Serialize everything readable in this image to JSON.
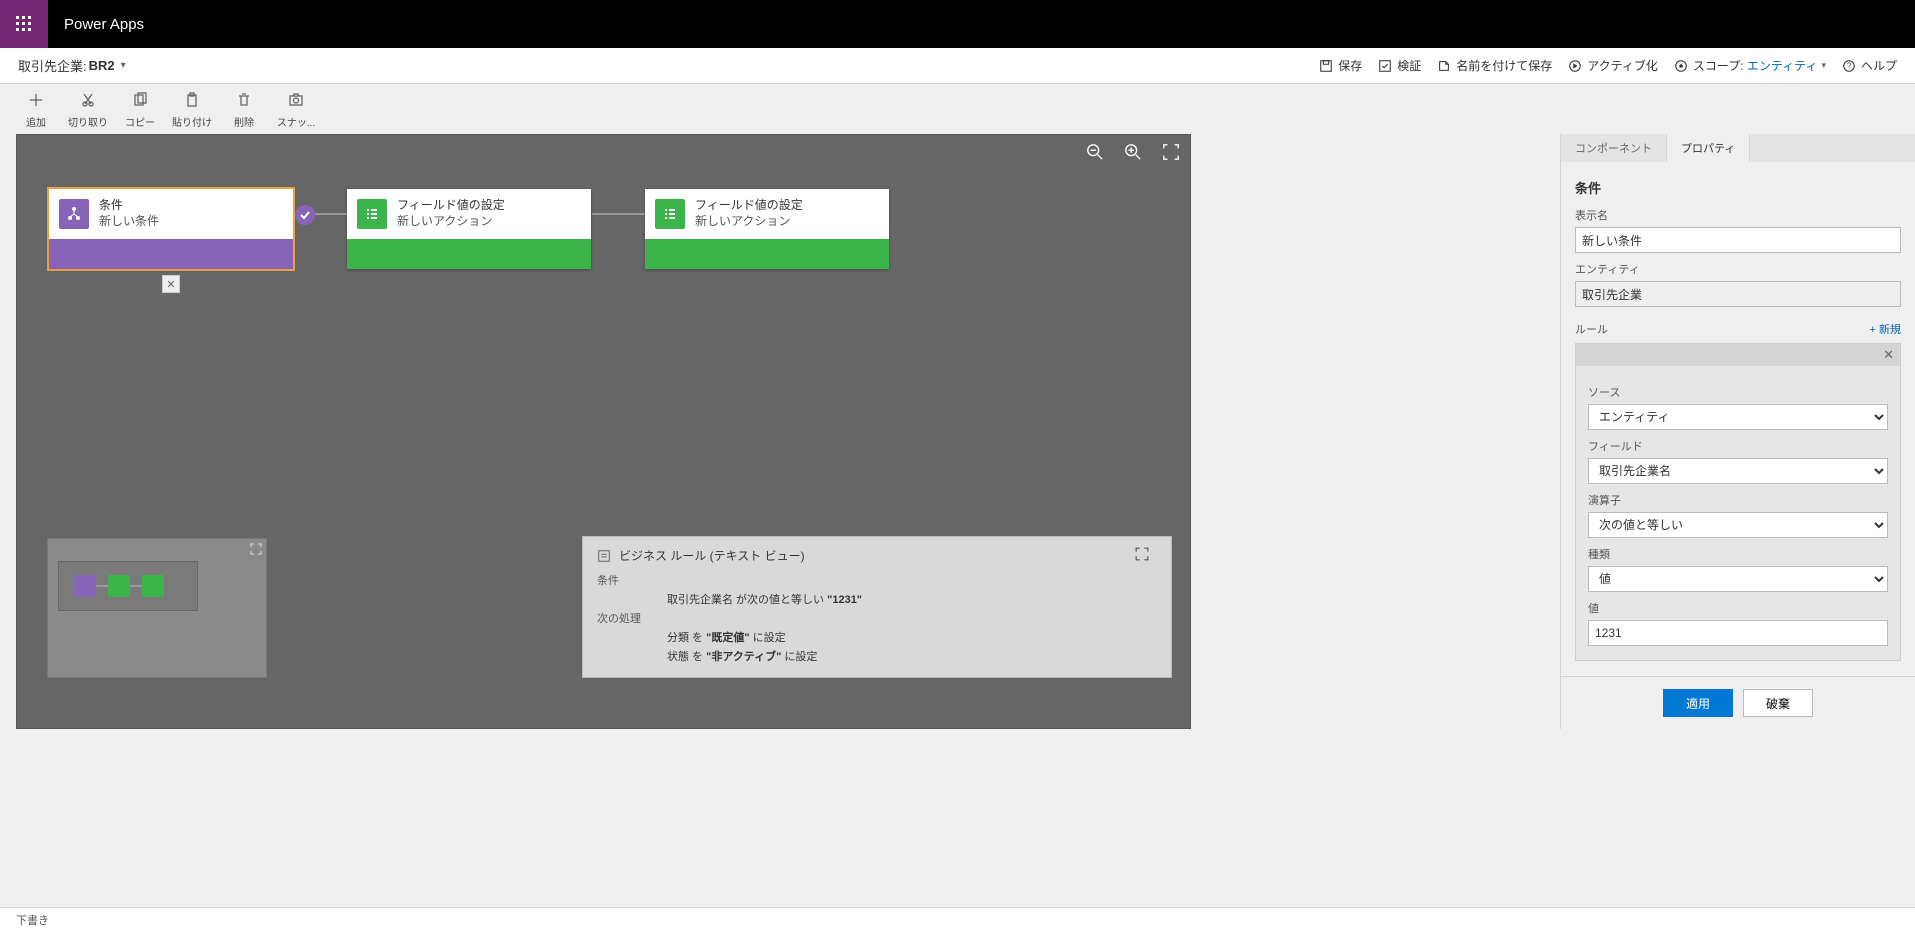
{
  "app_name": "Power Apps",
  "page": {
    "entity_prefix": "取引先企業:",
    "name": "BR2"
  },
  "commands": {
    "save": "保存",
    "validate": "検証",
    "save_as": "名前を付けて保存",
    "activate": "アクティブ化",
    "scope_label": "スコープ:",
    "scope_value": "エンティティ",
    "help": "ヘルプ"
  },
  "toolbar": {
    "add": "追加",
    "cut": "切り取り",
    "copy": "コピー",
    "paste": "貼り付け",
    "delete": "削除",
    "snapshot": "スナッ..."
  },
  "nodes": {
    "condition": {
      "title": "条件",
      "subtitle": "新しい条件"
    },
    "action1": {
      "title": "フィールド値の設定",
      "subtitle": "新しいアクション"
    },
    "action2": {
      "title": "フィールド値の設定",
      "subtitle": "新しいアクション"
    }
  },
  "textview": {
    "title": "ビジネス ルール (テキスト ビュー)",
    "cond_label": "条件",
    "cond_html": "取引先企業名 が次の値と等しい <b>\"1231\"</b>",
    "then_label": "次の処理",
    "then1_html": "分類 を <b>\"既定値\"</b> に設定",
    "then2_html": "状態 を <b>\"非アクティブ\"</b> に設定"
  },
  "panel": {
    "tabs": {
      "components": "コンポーネント",
      "properties": "プロパティ"
    },
    "section": "条件",
    "display_name_label": "表示名",
    "display_name_value": "新しい条件",
    "entity_label": "エンティティ",
    "entity_value": "取引先企業",
    "rule_label": "ルール",
    "add_new": "+ 新規",
    "source_label": "ソース",
    "source_value": "エンティティ",
    "field_label": "フィールド",
    "field_value": "取引先企業名",
    "operator_label": "演算子",
    "operator_value": "次の値と等しい",
    "type_label": "種類",
    "type_value": "値",
    "value_label": "値",
    "value_value": "1231",
    "apply": "適用",
    "discard": "破棄"
  },
  "footer": {
    "status": "下書き"
  }
}
